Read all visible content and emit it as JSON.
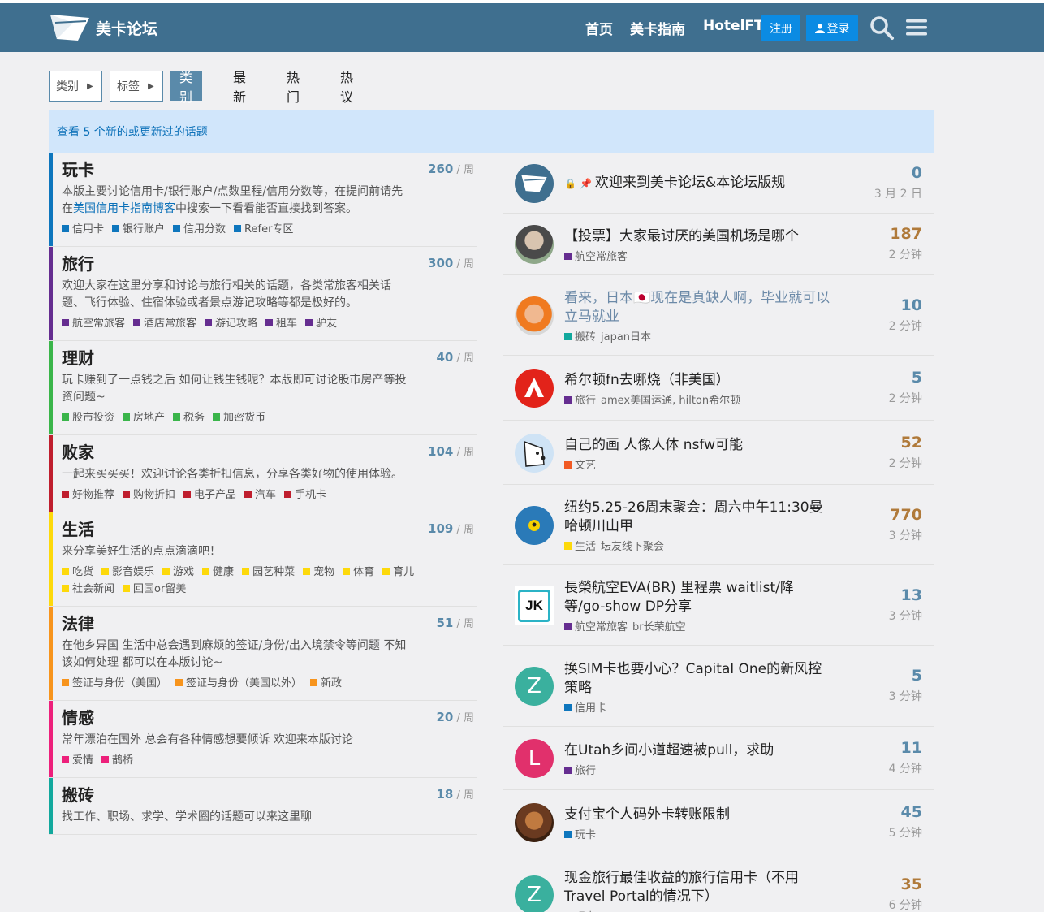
{
  "header": {
    "brand": "美卡论坛",
    "nav": [
      "首页",
      "美卡指南",
      "HotelFT"
    ],
    "register": "注册",
    "login": "登录"
  },
  "navbar": {
    "categories_dd": "类别",
    "tags_dd": "标签",
    "pills": [
      "类别",
      "最新",
      "热门",
      "热议"
    ]
  },
  "banner": "查看 5 个新的或更新过的话题",
  "categories": [
    {
      "name": "玩卡",
      "count": "260",
      "unit": "/ 周",
      "color": "#0e76bd",
      "desc_pre": "本版主要讨论信用卡/银行账户/点数里程/信用分数等，在提问前请先在",
      "desc_link": "美国信用卡指南博客",
      "desc_post": "中搜索一下看看能否直接找到答案。",
      "subs": [
        "信用卡",
        "银行账户",
        "信用分数",
        "Refer专区"
      ]
    },
    {
      "name": "旅行",
      "count": "300",
      "unit": "/ 周",
      "color": "#652d90",
      "desc_pre": "欢迎大家在这里分享和讨论与旅行相关的话题，各类常旅客相关话题、飞行体验、住宿体验或者景点游记攻略等都是极好的。",
      "desc_link": "",
      "desc_post": "",
      "subs": [
        "航空常旅客",
        "酒店常旅客",
        "游记攻略",
        "租车",
        "驴友"
      ]
    },
    {
      "name": "理财",
      "count": "40",
      "unit": "/ 周",
      "color": "#3ab54a",
      "desc_pre": "玩卡赚到了一点钱之后 如何让钱生钱呢？本版即可讨论股市房产等投资问题~",
      "desc_link": "",
      "desc_post": "",
      "subs": [
        "股市投资",
        "房地产",
        "税务",
        "加密货币"
      ]
    },
    {
      "name": "败家",
      "count": "104",
      "unit": "/ 周",
      "color": "#bf1e2e",
      "desc_pre": "一起来买买买！欢迎讨论各类折扣信息，分享各类好物的使用体验。",
      "desc_link": "",
      "desc_post": "",
      "subs": [
        "好物推荐",
        "购物折扣",
        "电子产品",
        "汽车",
        "手机卡"
      ]
    },
    {
      "name": "生活",
      "count": "109",
      "unit": "/ 周",
      "color": "#fdd90b",
      "desc_pre": "来分享美好生活的点点滴滴吧！",
      "desc_link": "",
      "desc_post": "",
      "subs": [
        "吃货",
        "影音娱乐",
        "游戏",
        "健康",
        "园艺种菜",
        "宠物",
        "体育",
        "育儿",
        "社会新闻",
        "回国or留美"
      ]
    },
    {
      "name": "法律",
      "count": "51",
      "unit": "/ 周",
      "color": "#f7941d",
      "desc_pre": "在他乡异国 生活中总会遇到麻烦的签证/身份/出入境禁令等问题 不知该如何处理 都可以在本版讨论~",
      "desc_link": "",
      "desc_post": "",
      "subs": [
        "签证与身份（美国）",
        "签证与身份（美国以外）",
        "新政"
      ]
    },
    {
      "name": "情感",
      "count": "20",
      "unit": "/ 周",
      "color": "#ed207b",
      "desc_pre": "常年漂泊在国外 总会有各种情感想要倾诉 欢迎来本版讨论",
      "desc_link": "",
      "desc_post": "",
      "subs": [
        "爱情",
        "鹊桥"
      ]
    },
    {
      "name": "搬砖",
      "count": "18",
      "unit": "/ 周",
      "color": "#12a89d",
      "desc_pre": "找工作、职场、求学、学术圈的话题可以来这里聊",
      "desc_link": "",
      "desc_post": "",
      "subs": []
    }
  ],
  "topics": [
    {
      "title": "欢迎来到美卡论坛&本论坛版规",
      "pinned": true,
      "cat": "",
      "cat_color": "",
      "tags": "",
      "count": "0",
      "time": "3 月 2 日",
      "hot": false,
      "muted": false,
      "avatar": "logo"
    },
    {
      "title": "【投票】大家最讨厌的美国机场是哪个",
      "pinned": false,
      "cat": "航空常旅客",
      "cat_color": "#652d90",
      "tags": "",
      "count": "187",
      "time": "2 分钟",
      "hot": true,
      "muted": false,
      "avatar": "photo1"
    },
    {
      "title": "看来，日本🇯🇵现在是真缺人啊，毕业就可以立马就业",
      "pinned": false,
      "cat": "搬砖",
      "cat_color": "#12a89d",
      "tags": "japan日本",
      "count": "10",
      "time": "2 分钟",
      "hot": false,
      "muted": true,
      "avatar": "photo2"
    },
    {
      "title": "希尔顿fn去哪烧（非美国）",
      "pinned": false,
      "cat": "旅行",
      "cat_color": "#652d90",
      "tags": "amex美国运通, hilton希尔顿",
      "count": "5",
      "time": "2 分钟",
      "hot": false,
      "muted": false,
      "avatar": "adobe"
    },
    {
      "title": "自己的画 人像人体 nsfw可能",
      "pinned": false,
      "cat": "文艺",
      "cat_color": "#f15a24",
      "tags": "",
      "count": "52",
      "time": "2 分钟",
      "hot": true,
      "muted": false,
      "avatar": "dog"
    },
    {
      "title": "纽约5.25-26周末聚会：周六中午11:30曼哈顿川山甲",
      "pinned": false,
      "cat": "生活",
      "cat_color": "#fdd90b",
      "tags": "坛友线下聚会",
      "count": "770",
      "time": "3 分钟",
      "hot": true,
      "muted": false,
      "avatar": "blue"
    },
    {
      "title": "長榮航空EVA(BR) 里程票 waitlist/降等/go-show DP分享",
      "pinned": false,
      "cat": "航空常旅客",
      "cat_color": "#652d90",
      "tags": "br长荣航空",
      "count": "13",
      "time": "3 分钟",
      "hot": false,
      "muted": false,
      "avatar": "jk"
    },
    {
      "title": "换SIM卡也要小心？Capital One的新风控策略",
      "pinned": false,
      "cat": "信用卡",
      "cat_color": "#0e76bd",
      "tags": "",
      "count": "5",
      "time": "3 分钟",
      "hot": false,
      "muted": false,
      "avatar": "Z"
    },
    {
      "title": "在Utah乡间小道超速被pull，求助",
      "pinned": false,
      "cat": "旅行",
      "cat_color": "#652d90",
      "tags": "",
      "count": "11",
      "time": "4 分钟",
      "hot": false,
      "muted": false,
      "avatar": "L"
    },
    {
      "title": "支付宝个人码外卡转账限制",
      "pinned": false,
      "cat": "玩卡",
      "cat_color": "#0e76bd",
      "tags": "",
      "count": "45",
      "time": "5 分钟",
      "hot": false,
      "muted": false,
      "avatar": "photo3"
    },
    {
      "title": "现金旅行最佳收益的旅行信用卡（不用Travel Portal的情况下）",
      "pinned": false,
      "cat": "玩卡",
      "cat_color": "#0e76bd",
      "tags": "",
      "count": "35",
      "time": "6 分钟",
      "hot": true,
      "muted": false,
      "avatar": "Z"
    }
  ]
}
